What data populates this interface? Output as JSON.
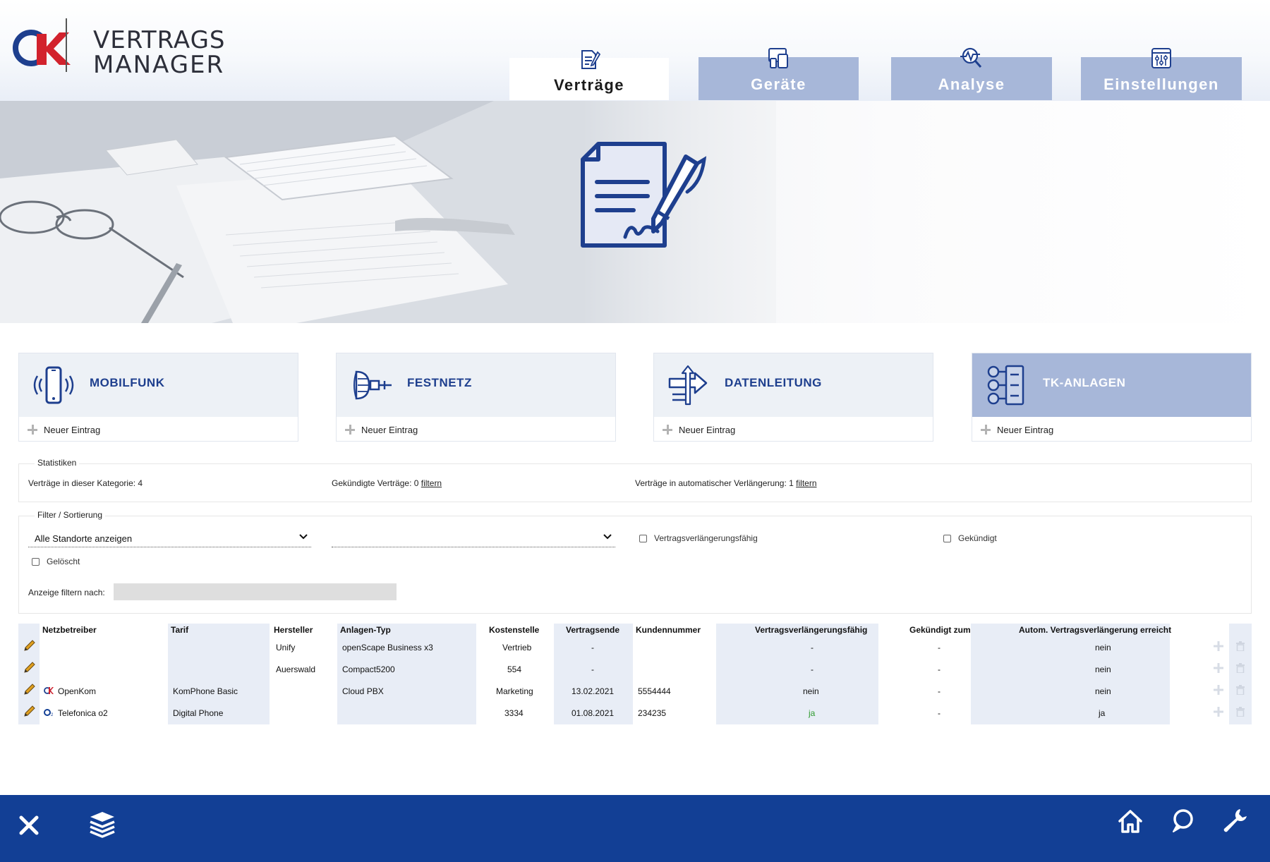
{
  "app": {
    "logo": {
      "line1": "VERTRAGS",
      "line2": "MANAGER"
    }
  },
  "nav": {
    "tabs": [
      {
        "label": "Verträge",
        "active": true,
        "icon": "contract-icon"
      },
      {
        "label": "Geräte",
        "active": false,
        "icon": "devices-icon"
      },
      {
        "label": "Analyse",
        "active": false,
        "icon": "analysis-icon"
      },
      {
        "label": "Einstellungen",
        "active": false,
        "icon": "settings-sliders-icon"
      }
    ]
  },
  "hero": {
    "icon": "contract-sign-icon"
  },
  "categories": [
    {
      "title": "MOBILFUNK",
      "new_label": "Neuer Eintrag",
      "icon": "mobile-phone-icon",
      "active": false
    },
    {
      "title": "FESTNETZ",
      "new_label": "Neuer Eintrag",
      "icon": "landline-connector-icon",
      "active": false
    },
    {
      "title": "DATENLEITUNG",
      "new_label": "Neuer Eintrag",
      "icon": "data-arrows-icon",
      "active": false
    },
    {
      "title": "TK-ANLAGEN",
      "new_label": "Neuer Eintrag",
      "icon": "tk-system-icon",
      "active": true
    }
  ],
  "stats": {
    "legend": "Statistiken",
    "count_text": "Verträge in dieser Kategorie: 4",
    "cancelled_text": "Gekündigte Verträge: 0",
    "cancelled_link": "filtern",
    "auto_text": "Verträge in automatischer Verlängerung: 1",
    "auto_link": "filtern"
  },
  "filter": {
    "legend": "Filter / Sortierung",
    "location_select": "Alle Standorte anzeigen",
    "second_select": "",
    "cb_renewable": "Vertragsverlängerungsfähig",
    "cb_cancelled": "Gekündigt",
    "cb_deleted": "Gelöscht",
    "search_label": "Anzeige filtern nach:",
    "search_value": ""
  },
  "table": {
    "headers": {
      "netz": "Netzbetreiber",
      "tarif": "Tarif",
      "hersteller": "Hersteller",
      "typ": "Anlagen-Typ",
      "kst": "Kostenstelle",
      "ende": "Vertragsende",
      "kdnr": "Kundennummer",
      "vvf": "Vertragsverlängerungsfähig",
      "gek": "Gekündigt zum",
      "auto": "Autom. Vertragsverlängerung erreicht"
    },
    "rows": [
      {
        "netz": "",
        "netz_logo": "",
        "tarif": "",
        "hersteller": "Unify",
        "typ": "openScape Business x3",
        "kst": "Vertrieb",
        "ende": "-",
        "kdnr": "",
        "vvf": "-",
        "gek": "-",
        "auto": "nein"
      },
      {
        "netz": "",
        "netz_logo": "",
        "tarif": "",
        "hersteller": "Auerswald",
        "typ": "Compact5200",
        "kst": "554",
        "ende": "-",
        "kdnr": "",
        "vvf": "-",
        "gek": "-",
        "auto": "nein"
      },
      {
        "netz": "OpenKom",
        "netz_logo": "openkom-logo-icon",
        "tarif": "KomPhone Basic",
        "hersteller": "",
        "typ": "Cloud PBX",
        "kst": "Marketing",
        "ende": "13.02.2021",
        "kdnr": "5554444",
        "vvf": "nein",
        "gek": "-",
        "auto": "nein"
      },
      {
        "netz": "Telefonica o2",
        "netz_logo": "o2-logo-icon",
        "tarif": "Digital Phone",
        "hersteller": "",
        "typ": "",
        "kst": "3334",
        "ende": "01.08.2021",
        "kdnr": "234235",
        "vvf": "ja",
        "gek": "-",
        "auto": "ja"
      }
    ]
  },
  "footer": {
    "icons": [
      "close-icon",
      "layers-icon",
      "home-icon",
      "chat-icon",
      "wrench-icon"
    ]
  },
  "colors": {
    "brand_blue": "#123f95",
    "accent_blue": "#1e3f8e",
    "tab_inactive": "#a7b7d9",
    "logo_red": "#d2222d",
    "yes_green": "#2e9a2e"
  }
}
